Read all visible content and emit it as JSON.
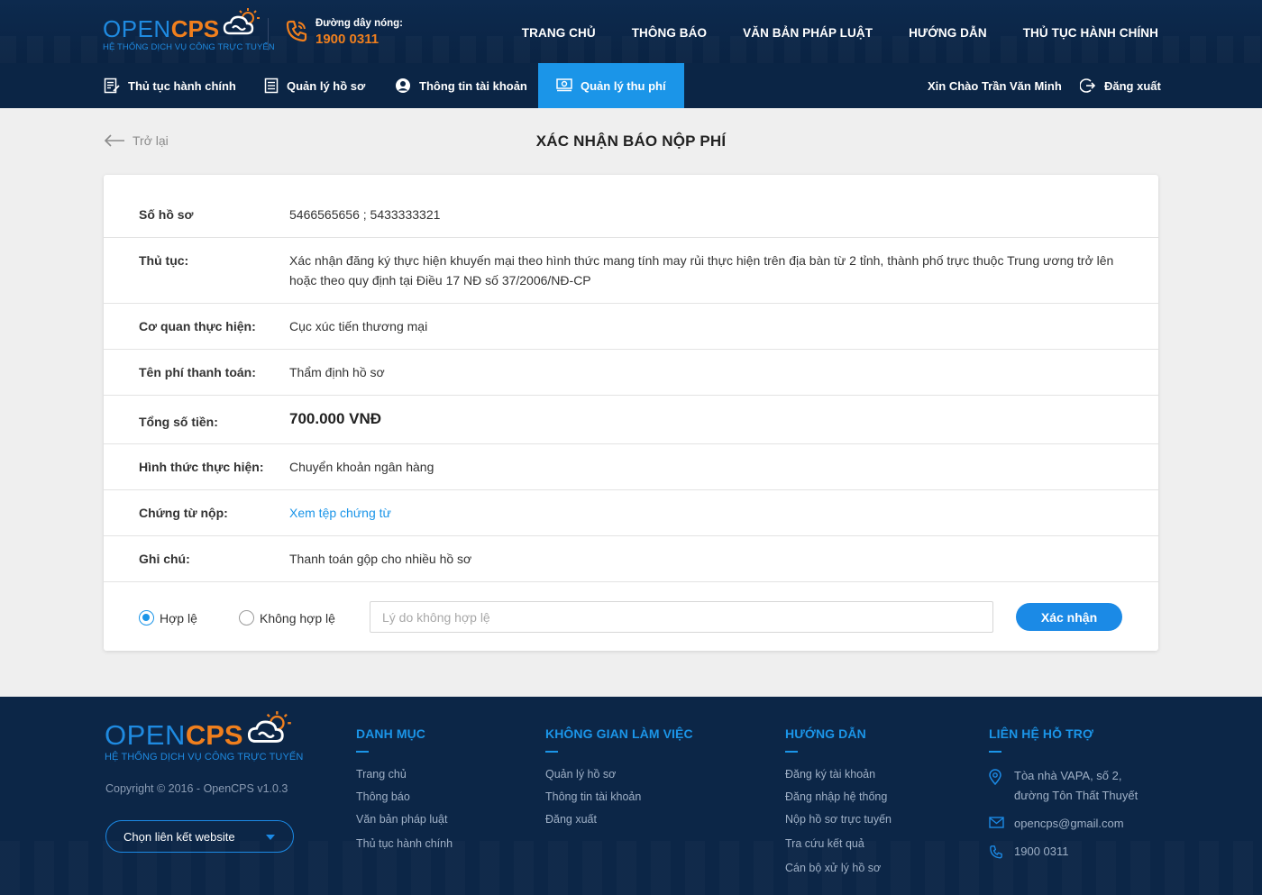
{
  "brand": {
    "name_part1": "OPEN",
    "name_part2": "CPS",
    "tagline": "HỆ THỐNG DỊCH VỤ CÔNG TRỰC TUYẾN"
  },
  "hotline": {
    "label": "Đường dây nóng:",
    "number": "1900 0311"
  },
  "main_nav": [
    "TRANG CHỦ",
    "THÔNG BÁO",
    "VĂN BẢN PHÁP LUẬT",
    "HƯỚNG DẪN",
    "THỦ TỤC HÀNH CHÍNH"
  ],
  "sub_nav": {
    "items": [
      {
        "label": "Thủ tục hành chính",
        "icon": "document-edit-icon"
      },
      {
        "label": "Quản lý hồ sơ",
        "icon": "file-list-icon"
      },
      {
        "label": "Thông tin tài khoản",
        "icon": "user-circle-icon"
      },
      {
        "label": "Quản lý thu phí",
        "icon": "money-icon",
        "active": true
      }
    ],
    "greeting": "Xin Chào Trần Văn Minh",
    "logout": "Đăng xuất"
  },
  "page": {
    "back_label": "Trở lại",
    "title": "XÁC NHẬN BÁO NỘP PHÍ"
  },
  "details": [
    {
      "label": "Số hồ sơ",
      "value": "5466565656 ; 5433333321"
    },
    {
      "label": "Thủ tục:",
      "value": "Xác nhận đăng ký thực hiện khuyến mại theo hình thức mang tính may rủi thực hiện trên địa bàn từ 2 tỉnh, thành phố trực thuộc Trung ương trở lên hoặc theo quy định tại Điều 17 NĐ số 37/2006/NĐ-CP"
    },
    {
      "label": "Cơ quan thực hiện:",
      "value": "Cục xúc tiến thương mại"
    },
    {
      "label": "Tên phí thanh toán:",
      "value": "Thẩm định hồ sơ"
    },
    {
      "label": "Tổng số tiền:",
      "value": "700.000 VNĐ"
    },
    {
      "label": "Hình thức thực hiện:",
      "value": "Chuyển khoản ngân hàng"
    },
    {
      "label": "Chứng từ nộp:",
      "value": "Xem tệp chứng từ"
    },
    {
      "label": "Ghi chú:",
      "value": "Thanh toán gộp cho nhiều hồ sơ"
    }
  ],
  "validation": {
    "valid_label": "Hợp lệ",
    "invalid_label": "Không hợp lệ",
    "selected": "Hợp lệ",
    "reason_placeholder": "Lý do không hợp lệ",
    "reason_value": "",
    "confirm_label": "Xác nhận"
  },
  "footer": {
    "copyright": "Copyright © 2016 - OpenCPS v1.0.3",
    "select_label": "Chọn liên kết website",
    "columns": [
      {
        "title": "DANH MỤC",
        "links": [
          "Trang chủ",
          "Thông báo",
          "Văn bản pháp luật",
          "Thủ tục hành chính"
        ]
      },
      {
        "title": "KHÔNG GIAN LÀM VIỆC",
        "links": [
          "Quản lý hồ sơ",
          "Thông tin tài khoản",
          "Đăng xuất"
        ]
      },
      {
        "title": "HƯỚNG DẪN",
        "links": [
          "Đăng ký tài khoản",
          "Đăng nhập hệ thống",
          "Nộp hồ sơ trực tuyến",
          "Tra cứu kết quả",
          "Cán bộ xử lý hồ sơ"
        ]
      }
    ],
    "contact": {
      "title": "LIÊN HỆ HỖ TRỢ",
      "address_line1": "Tòa nhà VAPA, số 2,",
      "address_line2": "đường Tôn Thất Thuyết",
      "email": "opencps@gmail.com",
      "phone": "1900 0311"
    }
  },
  "colors": {
    "header_bg": "#0c2647",
    "accent_blue": "#1b95e8",
    "brand_orange": "#f07f1d",
    "page_bg": "#efefef"
  }
}
